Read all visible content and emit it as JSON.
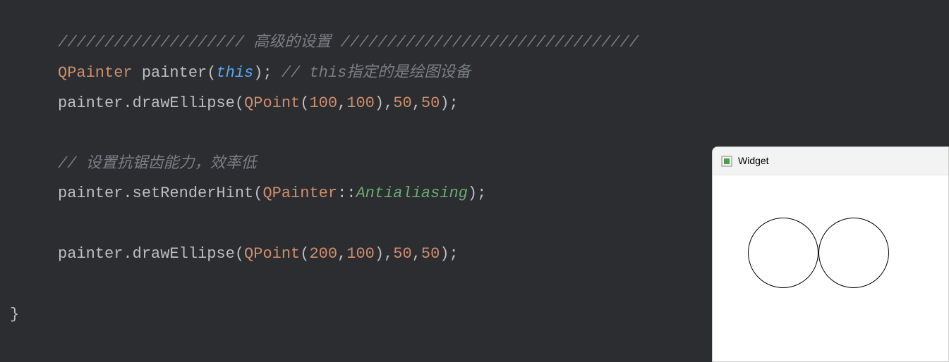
{
  "code": {
    "line1_comment": "//////////////////// 高级的设置 ////////////////////////////////",
    "line2_type": "QPainter",
    "line2_var": " painter(",
    "line2_this": "this",
    "line2_end": "); ",
    "line2_comment": "// this指定的是绘图设备",
    "line3_obj": "painter.drawEllipse(",
    "line3_qpoint": "QPoint",
    "line3_open": "(",
    "line3_n1": "100",
    "line3_c1": ",",
    "line3_n2": "100",
    "line3_close": "),",
    "line3_n3": "50",
    "line3_c2": ",",
    "line3_n4": "50",
    "line3_end": ");",
    "line5_comment": "// 设置抗锯齿能力，效率低",
    "line6_a": "painter.setRenderHint(",
    "line6_qp": "QPainter",
    "line6_scope": "::",
    "line6_enum": "Antialiasing",
    "line6_end": ");",
    "line8_obj": "painter.drawEllipse(",
    "line8_qpoint": "QPoint",
    "line8_open": "(",
    "line8_n1": "200",
    "line8_c1": ",",
    "line8_n2": "100",
    "line8_close": "),",
    "line8_n3": "50",
    "line8_c2": ",",
    "line8_n4": "50",
    "line8_end": ");",
    "brace": "}"
  },
  "window": {
    "title": "Widget"
  }
}
